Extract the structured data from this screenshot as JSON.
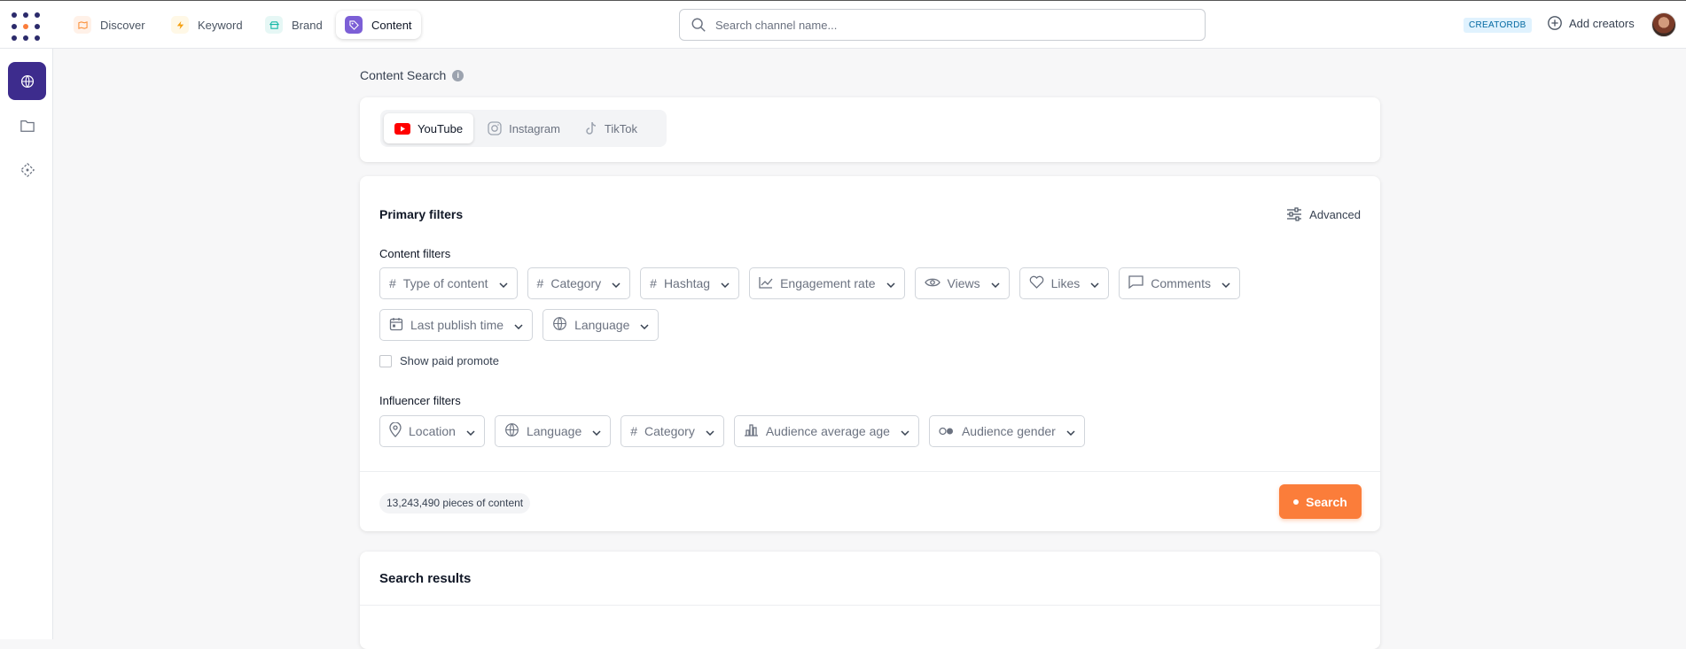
{
  "nav": {
    "tabs": [
      {
        "label": "Discover",
        "icon": "map-icon",
        "color": "#fb923c",
        "bg": "#fff1e8"
      },
      {
        "label": "Keyword",
        "icon": "bolt-icon",
        "color": "#f59e0b",
        "bg": "#fff8e6"
      },
      {
        "label": "Brand",
        "icon": "shop-icon",
        "color": "#14b8a6",
        "bg": "#e6f7f5"
      },
      {
        "label": "Content",
        "icon": "tag-icon",
        "color": "#ffffff",
        "bg": "#7c5fd6"
      }
    ],
    "active_tab": "Content",
    "search_placeholder": "Search channel name...",
    "badge": "CREATORDB",
    "add_creators": "Add creators"
  },
  "page": {
    "title": "Content Search",
    "platforms": [
      "YouTube",
      "Instagram",
      "TikTok"
    ],
    "active_platform": "YouTube"
  },
  "filters": {
    "primary_title": "Primary filters",
    "advanced_label": "Advanced",
    "content_title": "Content filters",
    "content": [
      {
        "label": "Type of content",
        "icon": "hash-icon"
      },
      {
        "label": "Category",
        "icon": "hash-icon"
      },
      {
        "label": "Hashtag",
        "icon": "hash-icon"
      },
      {
        "label": "Engagement rate",
        "icon": "line-chart-icon"
      },
      {
        "label": "Views",
        "icon": "eye-icon"
      },
      {
        "label": "Likes",
        "icon": "heart-icon"
      },
      {
        "label": "Comments",
        "icon": "comment-icon"
      },
      {
        "label": "Last publish time",
        "icon": "calendar-icon"
      },
      {
        "label": "Language",
        "icon": "globe-icon"
      }
    ],
    "show_paid_promote": "Show paid promote",
    "influencer_title": "Influencer filters",
    "influencer": [
      {
        "label": "Location",
        "icon": "pin-icon"
      },
      {
        "label": "Language",
        "icon": "globe-icon"
      },
      {
        "label": "Category",
        "icon": "hash-icon"
      },
      {
        "label": "Audience average age",
        "icon": "bar-chart-icon"
      },
      {
        "label": "Audience gender",
        "icon": "gender-icon"
      }
    ],
    "count_text": "13,243,490 pieces of content",
    "search_button": "Search"
  },
  "results": {
    "title": "Search results"
  },
  "colors": {
    "accent": "#fb7d3a",
    "sidebar_active": "#3d2c8d",
    "youtube": "#ff0000"
  }
}
